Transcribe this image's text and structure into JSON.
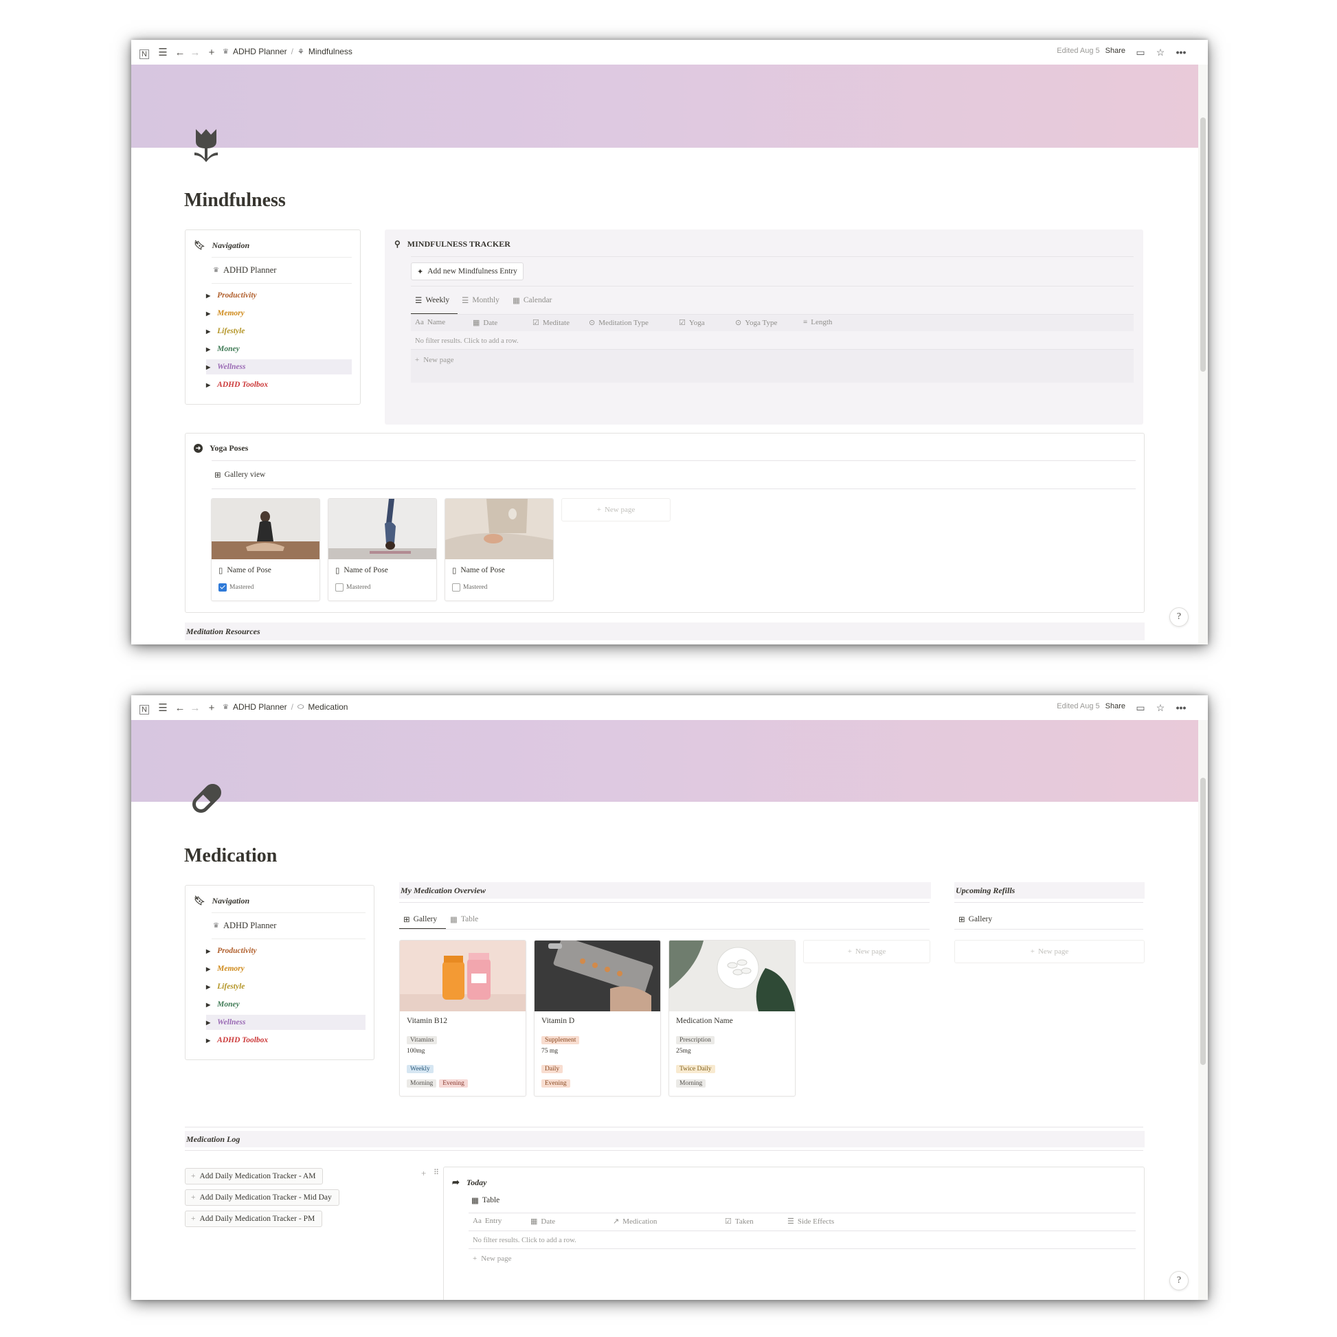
{
  "windows": [
    {
      "topbar": {
        "breadcrumb_root": "ADHD Planner",
        "breadcrumb_sep": "/",
        "breadcrumb_page": "Mindfulness",
        "edited": "Edited Aug 5",
        "share": "Share"
      },
      "page": {
        "title": "Mindfulness",
        "icon": "tulip-icon"
      },
      "navigation": {
        "heading": "Navigation",
        "planner_link": "ADHD Planner",
        "items": [
          "Productivity",
          "Memory",
          "Lifestyle",
          "Money",
          "Wellness",
          "ADHD Toolbox"
        ]
      },
      "tracker": {
        "heading": "MINDFULNESS TRACKER",
        "add_button": "Add new Mindfulness Entry",
        "tabs": [
          "Weekly",
          "Monthly",
          "Calendar"
        ],
        "columns": [
          "Name",
          "Date",
          "Meditate",
          "Meditation Type",
          "Yoga",
          "Yoga Type",
          "Length"
        ],
        "empty_text": "No filter results. Click to add a row.",
        "new_page": "New page"
      },
      "yoga": {
        "heading": "Yoga Poses",
        "view": "Gallery view",
        "cards": [
          {
            "title": "Name of Pose",
            "property": "Mastered",
            "checked": true
          },
          {
            "title": "Name of Pose",
            "property": "Mastered",
            "checked": false
          },
          {
            "title": "Name of Pose",
            "property": "Mastered",
            "checked": false
          }
        ],
        "new_page": "New page"
      },
      "footer_section": "Meditation Resources"
    },
    {
      "topbar": {
        "breadcrumb_root": "ADHD Planner",
        "breadcrumb_sep": "/",
        "breadcrumb_page": "Medication",
        "edited": "Edited Aug 5",
        "share": "Share"
      },
      "page": {
        "title": "Medication",
        "icon": "pill-icon"
      },
      "navigation": {
        "heading": "Navigation",
        "planner_link": "ADHD Planner",
        "items": [
          "Productivity",
          "Memory",
          "Lifestyle",
          "Money",
          "Wellness",
          "ADHD Toolbox"
        ]
      },
      "overview": {
        "heading": "My Medication Overview",
        "tabs": [
          "Gallery",
          "Table"
        ],
        "cards": [
          {
            "name": "Vitamin B12",
            "type": "Vitamins",
            "dose": "100mg",
            "frequency": "Weekly",
            "times": [
              "Morning",
              "Evening"
            ]
          },
          {
            "name": "Vitamin D",
            "type": "Supplement",
            "dose": "75 mg",
            "frequency": "Daily",
            "times": [
              "Evening"
            ]
          },
          {
            "name": "Medication Name",
            "type": "Prescription",
            "dose": "25mg",
            "frequency": "Twice Daily",
            "times": [
              "Morning"
            ]
          }
        ],
        "new_page": "New page"
      },
      "refills": {
        "heading": "Upcoming Refills",
        "view": "Gallery",
        "new_page": "New page"
      },
      "log": {
        "heading": "Medication Log",
        "buttons": [
          "Add Daily Medication Tracker - AM",
          "Add Daily Medication Tracker - Mid Day",
          "Add Daily Medication Tracker - PM"
        ],
        "today": {
          "heading": "Today",
          "view": "Table",
          "columns": [
            "Entry",
            "Date",
            "Medication",
            "Taken",
            "Side Effects"
          ],
          "empty_text": "No filter results. Click to add a row.",
          "new_page": "New page"
        }
      }
    }
  ],
  "colors": {
    "productivity": "#b05f2c",
    "memory": "#cf8a1b",
    "lifestyle": "#b39425",
    "money": "#3f7a55",
    "wellness": "#9a6ab4",
    "toolbox": "#cc3b3b",
    "cover_start": "#d7c6e0",
    "cover_end": "#e9cad9"
  }
}
